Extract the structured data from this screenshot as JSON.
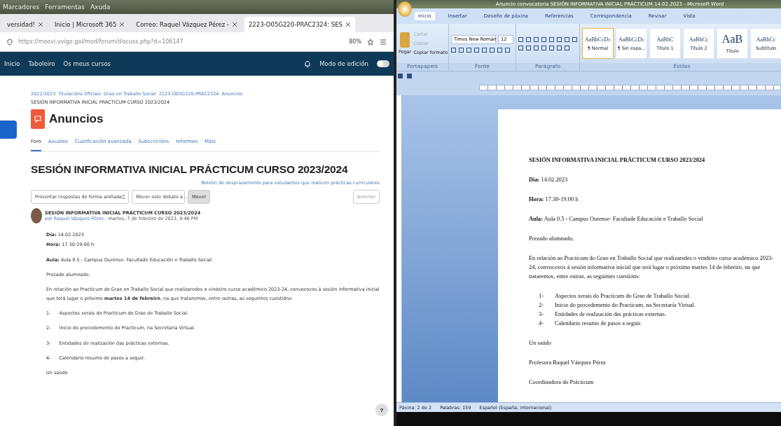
{
  "browser": {
    "menu": [
      "Marcadores",
      "Ferramentas",
      "Axuda"
    ],
    "tabs": [
      {
        "label": "versidad!",
        "selected": false
      },
      {
        "label": "Inicio | Microsoft 365",
        "selected": false
      },
      {
        "label": "Correo: Raquel Vázquez Pérez -",
        "selected": false
      },
      {
        "label": "2223-O05G220-PRAC2324: SES",
        "selected": true
      }
    ],
    "address": "https://moovi.uvigo.gal/mod/forum/discuss.php?d=106147",
    "zoom": "80%"
  },
  "site": {
    "nav": [
      "Inicio",
      "Taboleiro",
      "Os meus cursos"
    ],
    "edit_mode": {
      "label": "Modo de edición",
      "on": false
    },
    "breadcrumb": [
      "2022/2023",
      "Titulacións Oficiais",
      "Grao en Traballo Social",
      "2223-O05G220-PRAC2324",
      "Anuncios",
      "SESIÓN INFORMATIVA INICIAL PRÁCTICUM CURSO 2023/2024"
    ],
    "heading": "Anuncios",
    "subnav": [
      {
        "label": "Foro",
        "selected": true
      },
      {
        "label": "Axustes",
        "selected": false
      },
      {
        "label": "Cualificación avanzada",
        "selected": false
      },
      {
        "label": "Subscricións",
        "selected": false
      },
      {
        "label": "Informes",
        "selected": false
      },
      {
        "label": "Máis",
        "selected": false
      }
    ],
    "title": "SESIÓN INFORMATIVA INICIAL PRÁCTICUM CURSO 2023/2024",
    "link": "Boletín de desprazamento para estudantes que realicen prácticas curriculares",
    "display_select": "Presentar respostas de forma aniñada",
    "move_select": "Mover este debate a ...",
    "move_button": "Mover",
    "nav_button": "Anterior",
    "post": {
      "title": "SESIÓN INFORMATIVA INICIAL PRÁCTICUM CURSO 2023/2024",
      "author": "por Raquel Vázquez Pérez",
      "date": " - martes, 7 de febreiro de 2023, 9:46 PM",
      "lines": [
        "**Día:** 14.02.2023",
        "**Hora:** 17.30-19:00 h"
      ],
      "aula": "**Aula:** Aula 0.5 -  Campus Ourense- Facultade Educación e Traballo Social",
      "greeting": "Prezado alumnado;",
      "paragraph": "En relación ao Practicum do Grao en Traballo Social que realizaredes o vindeiro curso académico 2023-24, convocovos á sesión informativa inicial que terá lugar o próximo **martes 14 de febreiro**, na que trataremos, entre outras, as seguintes cuestións:",
      "items": [
        {
          "num": "1-",
          "text": "Aspectos xerais do Practicum do Grao de Traballo Social."
        },
        {
          "num": "2-",
          "text": "Inicio do procedemento do Practicum, na Secretaría Virtual."
        },
        {
          "num": "3-",
          "text": "Entidades de realización das prácticas externas."
        },
        {
          "num": "4-",
          "text": "Calendario resumo de pasos a seguir."
        }
      ],
      "closing": "Un saúdo"
    },
    "help": "?"
  },
  "word": {
    "title": "Anuncio convocatoria SESIÓN INFORMATIVA INICIAL PRÁCTICUM 14.02.2023 - Microsoft Word",
    "tabs": [
      {
        "label": "Inicio",
        "selected": true
      },
      {
        "label": "Insertar",
        "selected": false
      },
      {
        "label": "Deseño de páxina",
        "selected": false
      },
      {
        "label": "Referencias",
        "selected": false
      },
      {
        "label": "Correspondencia",
        "selected": false
      },
      {
        "label": "Revisar",
        "selected": false
      },
      {
        "label": "Vista",
        "selected": false
      }
    ],
    "clipboard": {
      "paste": "Pegar",
      "cut": "Cortar",
      "copy": "Copiar",
      "format": "Copiar formato"
    },
    "font": "Times New Roman",
    "size": "12",
    "styles": [
      {
        "sample": "AaBbCcDc",
        "name": "¶ Normal",
        "selected": true
      },
      {
        "sample": "AaBbCcDc",
        "name": "¶ Sin espa...",
        "selected": false
      },
      {
        "sample": "AaBbC",
        "name": "Título 1",
        "selected": false
      },
      {
        "sample": "AaBbCc",
        "name": "Título 2",
        "selected": false
      },
      {
        "sample": "AaB",
        "name": "Título",
        "selected": false
      },
      {
        "sample": "AaBbCc",
        "name": "Subtítulo",
        "selected": false
      }
    ],
    "groups": [
      "Portapapeis",
      "Fonte",
      "Parágrafo",
      "Estilos"
    ],
    "doc": {
      "title": "SESIÓN INFORMATIVA INICIAL PRÁCTICUM CURSO 2023/2024",
      "lines": [
        "**Día:** 14.02.2023",
        "**Hora:** 17.30-19:00 h",
        "**Aula:** Aula 0.5 -  Campus Ourense- Facultade Educación e Traballo Social"
      ],
      "greeting": "Prezado alumnado,",
      "paragraph": "En relación ao Practicum do Grao en Traballo Social que realizaredes o vindeiro curso académico 2023-24, convocovos á sesión informativa inicial que terá lugar o próximo martes 14 de febreiro, na que trataremos, entre outras, as seguintes cuestións:",
      "items": [
        {
          "num": "1-",
          "text": "Aspectos xerais do Practicum do Grao de Traballo Social."
        },
        {
          "num": "2-",
          "text": "Inicio do procedemento do Practicum, na Secretaría Virtual."
        },
        {
          "num": "3-",
          "text": "Entidades de realización das prácticas externas."
        },
        {
          "num": "4-",
          "text": "Calendario resumo de pasos a seguir."
        }
      ],
      "closing": "Un saúdo",
      "signature": "Profesora Raquel Vázquez Pérez",
      "role": "Coordinadora do Prácticum"
    },
    "status": [
      "Páxina: 2 de 2",
      "Palabras: 159",
      "Español (España, internacional)"
    ]
  }
}
